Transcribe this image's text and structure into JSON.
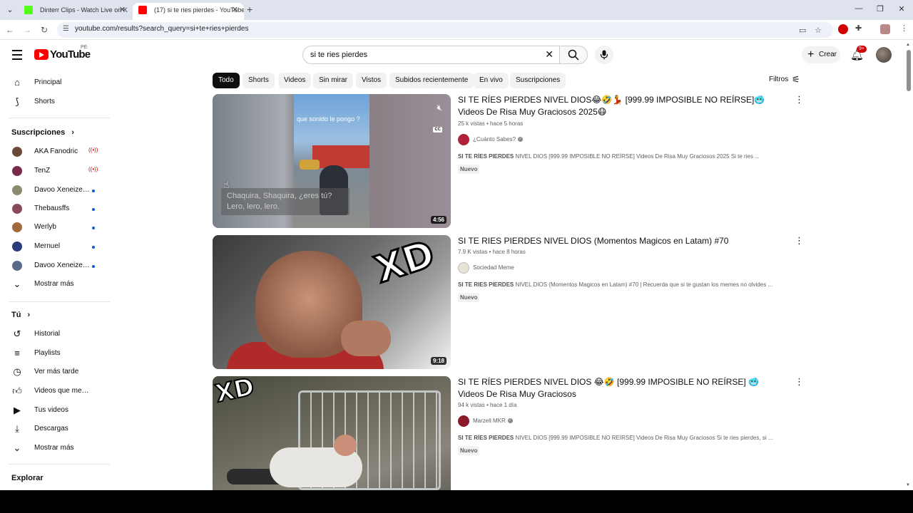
{
  "browser": {
    "tabs": [
      {
        "title": "Dinterr Clips - Watch Live on K",
        "active": false
      },
      {
        "title": "(17) si te ries pierdes - YouTube",
        "active": true
      }
    ],
    "url": "youtube.com/results?search_query=si+te+ries+pierdes"
  },
  "header": {
    "logo": "YouTube",
    "country": "PE",
    "search_query": "si te ries pierdes",
    "create_label": "Crear",
    "notif_badge": "9+"
  },
  "sidebar": {
    "main": [
      {
        "label": "Principal",
        "icon": "home-icon"
      },
      {
        "label": "Shorts",
        "icon": "shorts-icon"
      }
    ],
    "subs_title": "Suscripciones",
    "subs": [
      {
        "label": "AKA Fanodric",
        "status": "live",
        "color": "#6b4a3a"
      },
      {
        "label": "TenZ",
        "status": "live",
        "color": "#7a2a4a"
      },
      {
        "label": "Davoo Xeneize P...",
        "status": "new",
        "color": "#8a8a70"
      },
      {
        "label": "Thebausffs",
        "status": "new",
        "color": "#8a4a5a"
      },
      {
        "label": "Werlyb",
        "status": "new",
        "color": "#a06a3a"
      },
      {
        "label": "Mernuel",
        "status": "new",
        "color": "#2a3a7a"
      },
      {
        "label": "Davoo Xeneize T...",
        "status": "new",
        "color": "#5a6a8a"
      }
    ],
    "show_more": "Mostrar más",
    "you_title": "Tú",
    "you": [
      {
        "label": "Historial",
        "icon": "history-icon"
      },
      {
        "label": "Playlists",
        "icon": "playlists-icon"
      },
      {
        "label": "Ver más tarde",
        "icon": "watch-later-icon"
      },
      {
        "label": "Videos que me gus...",
        "icon": "like-icon"
      },
      {
        "label": "Tus videos",
        "icon": "your-videos-icon"
      },
      {
        "label": "Descargas",
        "icon": "downloads-icon"
      }
    ],
    "show_more_2": "Mostrar más",
    "explore_title": "Explorar"
  },
  "chips": [
    "Todo",
    "Shorts",
    "Videos",
    "Sin mirar",
    "Vistos",
    "Subidos recientemente",
    "En vivo",
    "Suscripciones"
  ],
  "filters_label": "Filtros",
  "results": [
    {
      "title": "SI TE RÍES PIERDES NIVEL DIOS😂🤣💃 [999.99 IMPOSIBLE NO REÍRSE]🥶 Videos De Risa Muy Graciosos 2025😷",
      "meta": "25 k vistas • hace 5 horas",
      "channel": "¿Cuánto Sabes?",
      "desc_bold": "SI TE RÍES PIERDES",
      "desc": " NIVEL DIOS [999.99 IMPOSIBLE NO REÍRSE] Videos De Risa Muy Graciosos 2025 Si te ries ...",
      "badge": "Nuevo",
      "duration": "4:56",
      "overlay_text": "que sonido le pongo ?",
      "subtitle": "Chaquira, Shaquira, ¿eres tú? Lero, lero, lero."
    },
    {
      "title": "SI TE RIES PIERDES NIVEL DIOS (Momentos Magicos en Latam) #70",
      "meta": "7.9 K vistas • hace 8 horas",
      "channel": "Sociedad Meme",
      "desc_bold": "SI TE RIES PIERDES",
      "desc": " NIVEL DIOS (Momentos Magicos en Latam) #70 | Recuerda que si te gustan los memes no olvides ...",
      "badge": "Nuevo",
      "duration": "9:18",
      "overlay_text": "XD"
    },
    {
      "title": "SI TE RÍES PIERDES NIVEL DIOS 😂🤣 [999.99 IMPOSIBLE NO REÍRSE] 🥶 Videos De Risa Muy Graciosos",
      "meta": "94 k vistas • hace 1 día",
      "channel": "Marzell MKR",
      "desc_bold": "SI TE RÍES PIERDES",
      "desc": " NIVEL DIOS [999.99 IMPOSIBLE NO REÍRSE] Videos De Risa Muy Graciosos Si te ries pierdes, si ...",
      "badge": "Nuevo",
      "overlay_text": "XD"
    }
  ]
}
